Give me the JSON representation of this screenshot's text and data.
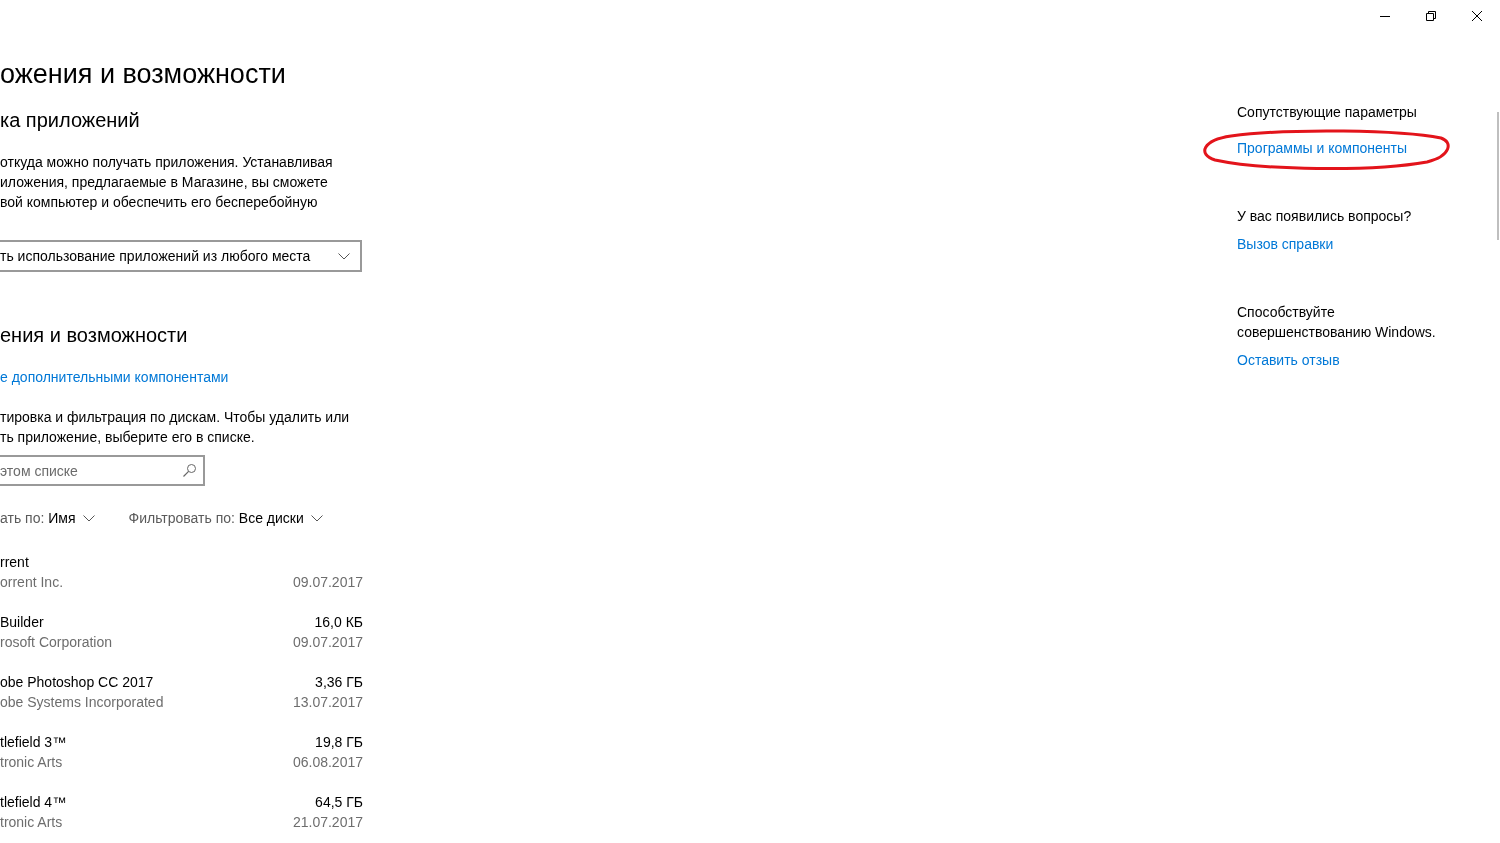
{
  "page": {
    "title": "ожения и возможности"
  },
  "install_section": {
    "heading": "ка приложений",
    "description_lines": [
      "откуда можно получать приложения. Устанавливая",
      "иложения, предлагаемые в Магазине, вы сможете",
      "вой компьютер и обеспечить его бесперебойную"
    ],
    "dropdown": {
      "value": "ть использование приложений из любого места"
    }
  },
  "apps_section": {
    "heading": "ения и возможности",
    "link": "е дополнительными компонентами",
    "description_lines": [
      "тировка и фильтрация по дискам. Чтобы удалить или",
      "ть приложение, выберите его в списке."
    ],
    "search": {
      "placeholder": "этом списке"
    },
    "sort": {
      "label": "ать по:",
      "value": "Имя"
    },
    "filter": {
      "label": "Фильтровать по:",
      "value": "Все диски"
    },
    "apps": [
      {
        "name": "rrent",
        "publisher": "orrent Inc.",
        "date": "09.07.2017"
      },
      {
        "name": "Builder",
        "publisher": "rosoft Corporation",
        "size": "16,0 КБ",
        "date": "09.07.2017"
      },
      {
        "name": "obe Photoshop CC 2017",
        "publisher": "obe Systems Incorporated",
        "size": "3,36 ГБ",
        "date": "13.07.2017"
      },
      {
        "name": "tlefield 3™",
        "publisher": "tronic Arts",
        "size": "19,8 ГБ",
        "date": "06.08.2017"
      },
      {
        "name": "tlefield 4™",
        "publisher": "tronic Arts",
        "size": "64,5 ГБ",
        "date": "21.07.2017"
      }
    ]
  },
  "sidebar": {
    "sections": [
      {
        "title": "Сопутствующие параметры",
        "links": [
          {
            "label": "Программы и компоненты",
            "highlighted": true
          }
        ]
      },
      {
        "title": "У вас появились вопросы?",
        "links": [
          {
            "label": "Вызов справки",
            "highlighted": false
          }
        ]
      },
      {
        "title": "Способствуйте совершенствованию Windows.",
        "links": [
          {
            "label": "Оставить отзыв",
            "highlighted": false
          }
        ]
      }
    ]
  }
}
